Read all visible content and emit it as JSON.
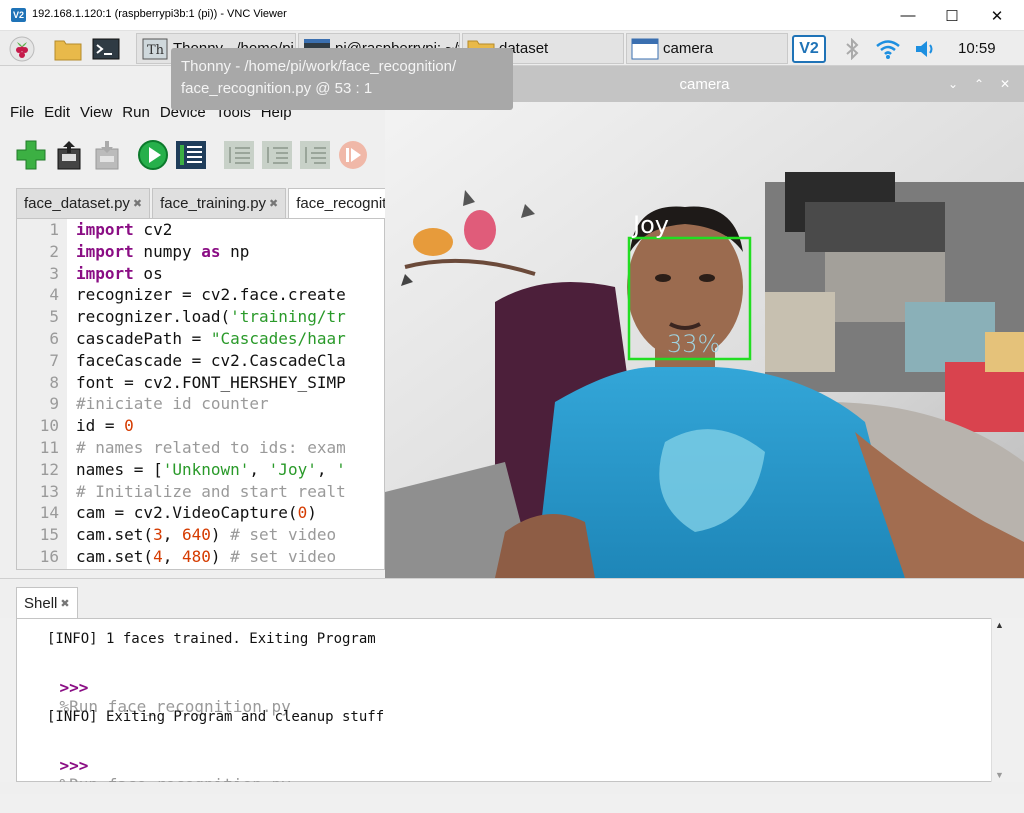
{
  "vnc": {
    "logo_text": "V2",
    "title": "192.168.1.120:1 (raspberrypi3b:1 (pi)) - VNC Viewer",
    "minimize": "—",
    "maximize": "☐",
    "close": "✕"
  },
  "taskbar": {
    "tasks": [
      {
        "label": "Thonny - /home/pi/work/face_recognition"
      },
      {
        "label": "pi@raspberrypi: ~/work/face_recognition"
      },
      {
        "label": "dataset"
      },
      {
        "label": "camera"
      }
    ],
    "vnc_tray_text": "V2",
    "clock": "10:59"
  },
  "tooltip": {
    "line1": "Thonny  -  /home/pi/work/face_recognition/",
    "line2": "face_recognition.py  @  53 : 1"
  },
  "thonny": {
    "menu": [
      "File",
      "Edit",
      "View",
      "Run",
      "Device",
      "Tools",
      "Help"
    ],
    "tabs": [
      {
        "label": "face_dataset.py",
        "close": "✖"
      },
      {
        "label": "face_training.py",
        "close": "✖"
      },
      {
        "label": "face_recognition.py"
      }
    ],
    "line_numbers": [
      "1",
      "2",
      "3",
      "4",
      "5",
      "6",
      "7",
      "8",
      "9",
      "10",
      "11",
      "12",
      "13",
      "14",
      "15",
      "16"
    ]
  },
  "camera": {
    "title": "camera",
    "btn_down": "⌄",
    "btn_up": "⌃",
    "btn_close": "✕",
    "face_label": "Joy",
    "confidence": "33%",
    "colors": {
      "box": "#22dd22",
      "label": "#ffffff",
      "confidence": "#9fd3e0"
    }
  },
  "shell": {
    "tab_label": "Shell",
    "tab_close": "✖",
    "info1": "[INFO] 1 faces trained. Exiting Program",
    "prompt": ">>>",
    "run1": "%Run face_recognition.py",
    "info2": "[INFO] Exiting Program and cleanup stuff",
    "run2": "%Run face_recognition.py"
  }
}
